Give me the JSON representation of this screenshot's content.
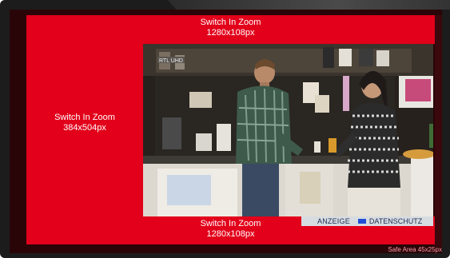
{
  "zones": {
    "top": {
      "title": "Switch In Zoom",
      "size": "1280x108px"
    },
    "left": {
      "title": "Switch In Zoom",
      "size": "384x504px"
    },
    "bottom": {
      "title": "Switch In Zoom",
      "size": "1280x108px"
    }
  },
  "video": {
    "logo_text": "RTL UHD"
  },
  "ad_bar": {
    "ad_label": "ANZEIGE",
    "privacy_label": "DATENSCHUTZ"
  },
  "safe_area": {
    "label": "Safe Area 45x25px"
  },
  "colors": {
    "zone_red": "#e2001a",
    "privacy_blue": "#1f4fd6",
    "tv_frame": "#1c1c1c"
  },
  "icons": {
    "privacy": "blue-square-icon"
  }
}
